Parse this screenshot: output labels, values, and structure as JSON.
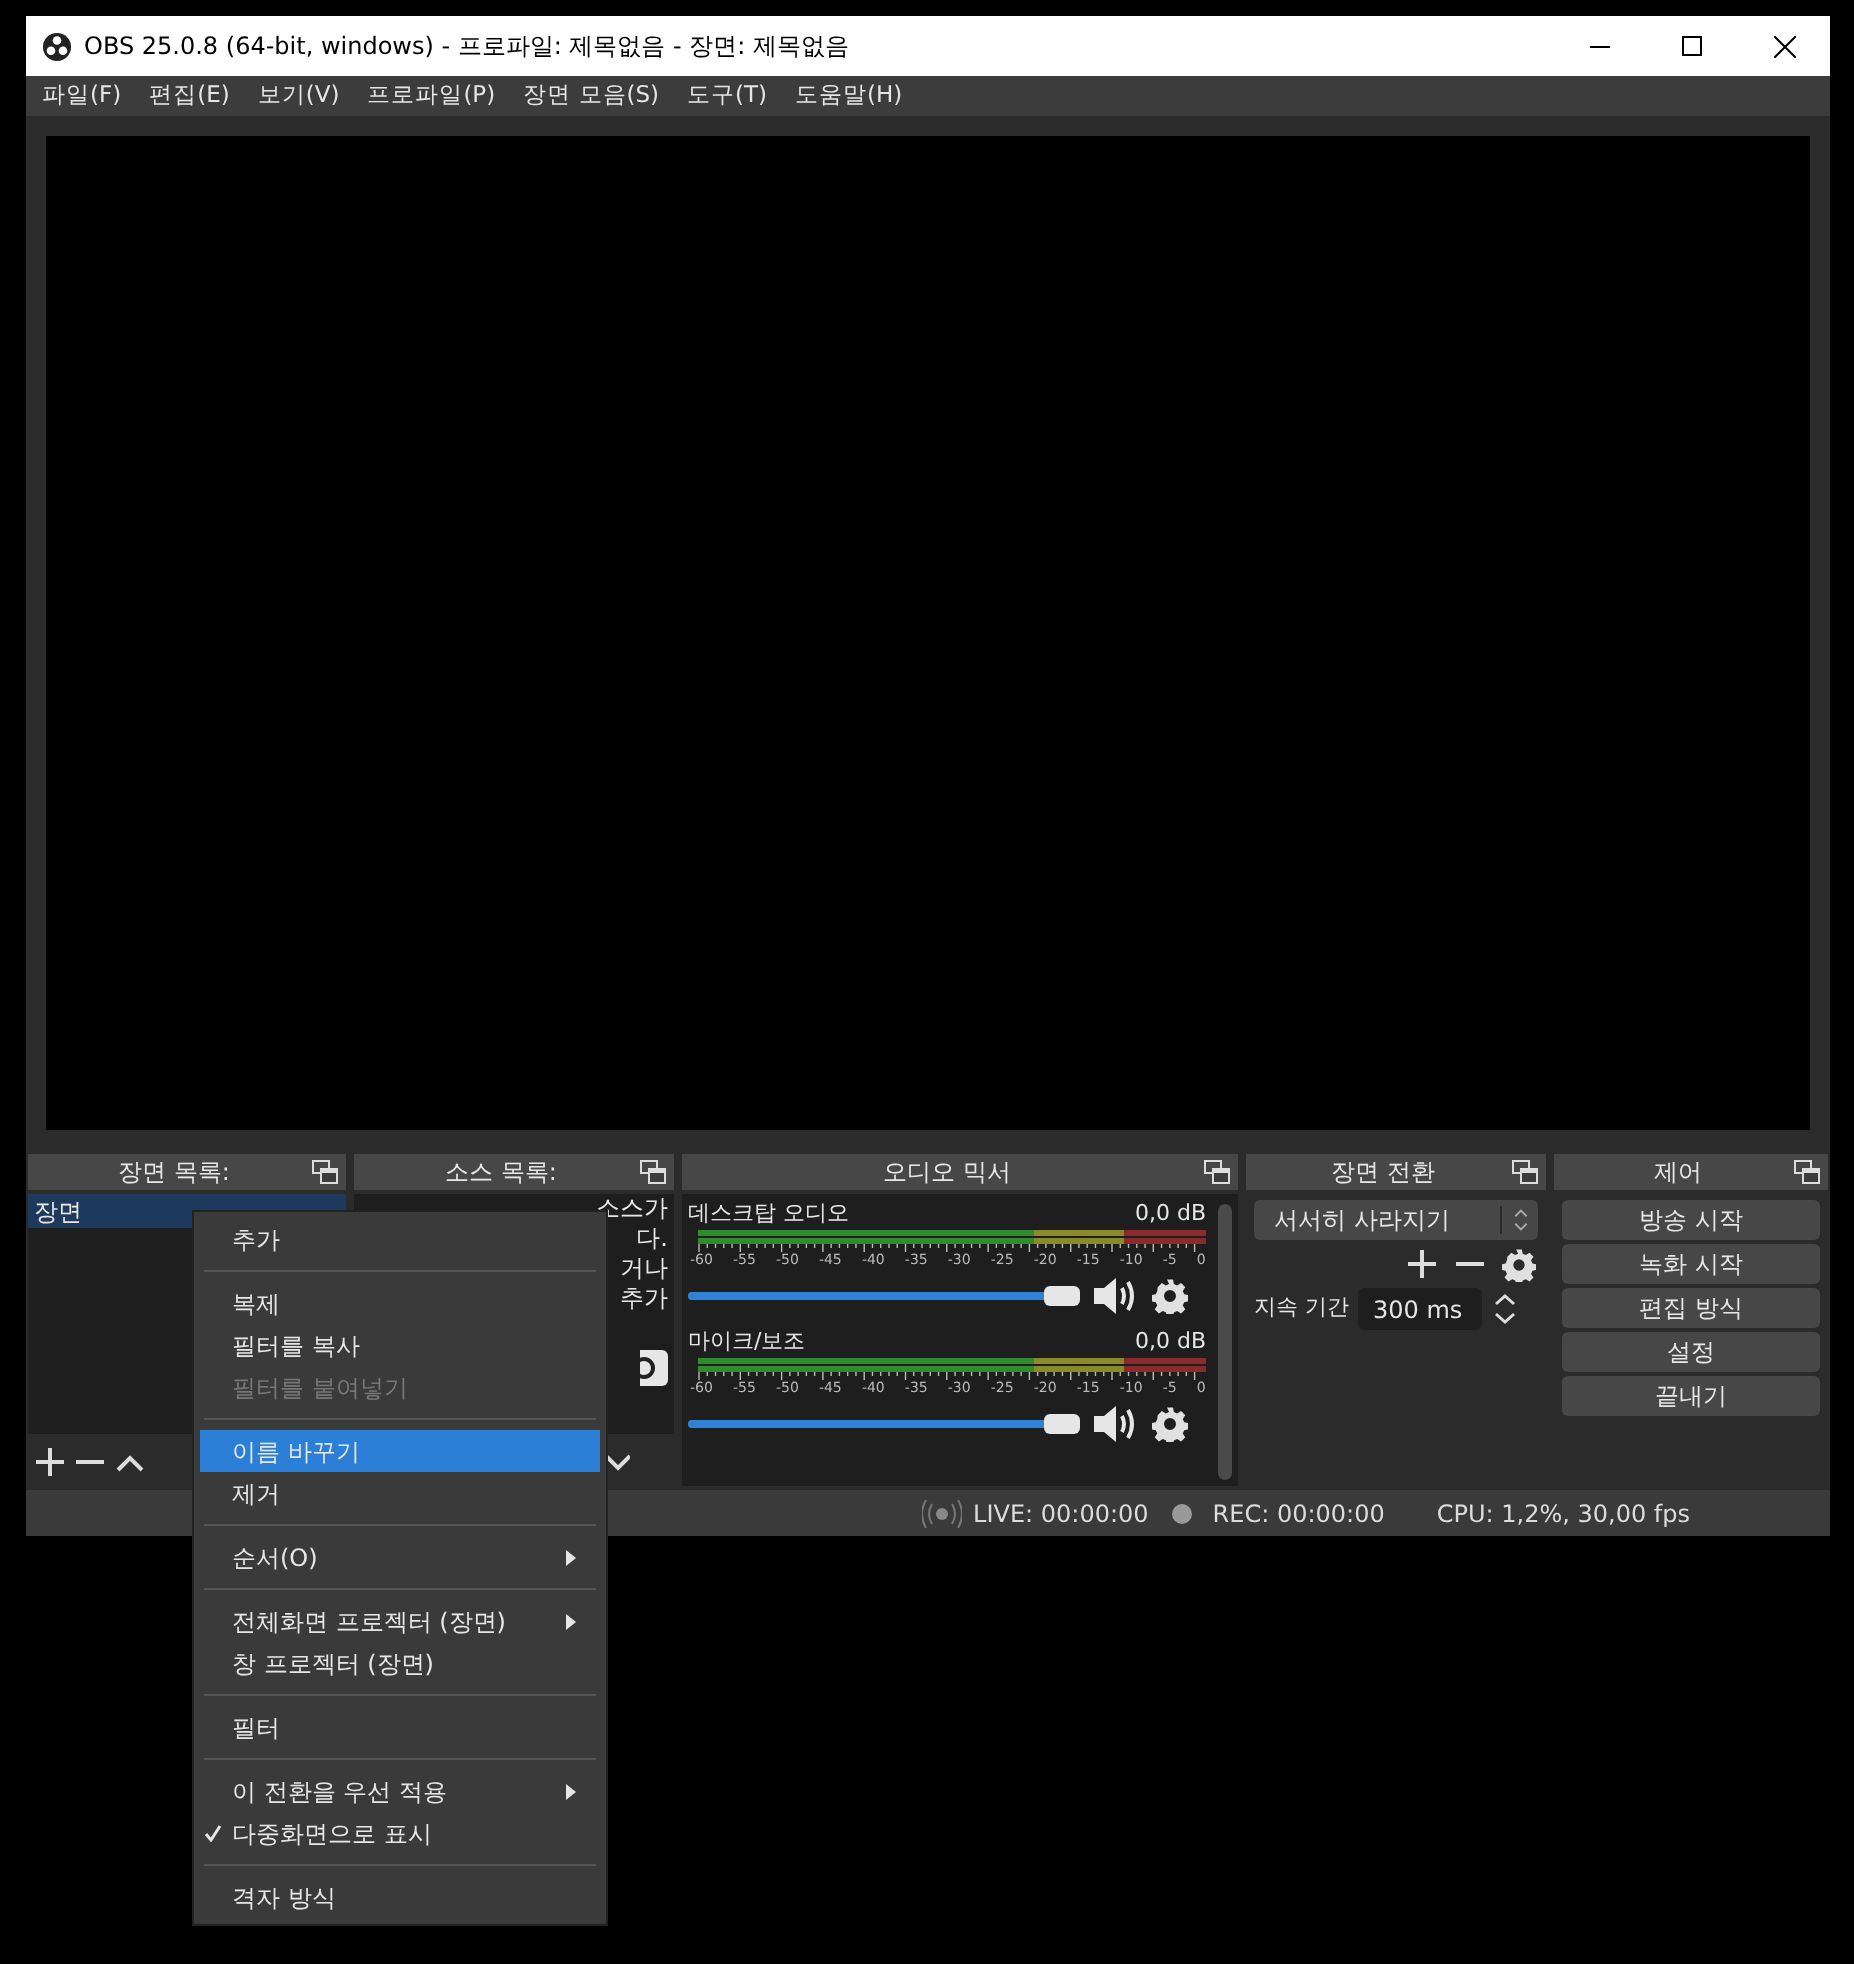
{
  "window": {
    "title": "OBS 25.0.8 (64-bit, windows) - 프로파일: 제목없음 - 장면: 제목없음"
  },
  "menubar": [
    "파일(F)",
    "편집(E)",
    "보기(V)",
    "프로파일(P)",
    "장면 모음(S)",
    "도구(T)",
    "도움말(H)"
  ],
  "scenes": {
    "title": "장면 목록:",
    "items": [
      {
        "label": "장면",
        "selected": true
      }
    ]
  },
  "sources": {
    "title": "소스 목록:",
    "text_lines": [
      "소스가",
      "다.",
      "거나",
      "추가"
    ]
  },
  "mixer": {
    "title": "오디오 믹서",
    "channels": [
      {
        "name": "데스크탑 오디오",
        "reading": "0,0 dB",
        "level": 1,
        "scale": [
          "-60",
          "-55",
          "-50",
          "-45",
          "-40",
          "-35",
          "-30",
          "-25",
          "-20",
          "-15",
          "-10",
          "-5",
          "0"
        ]
      },
      {
        "name": "마이크/보조",
        "reading": "0,0 dB",
        "level": 1,
        "scale": [
          "-60",
          "-55",
          "-50",
          "-45",
          "-40",
          "-35",
          "-30",
          "-25",
          "-20",
          "-15",
          "-10",
          "-5",
          "0"
        ]
      }
    ]
  },
  "transitions": {
    "title": "장면 전환",
    "selected": "서서히 사라지기",
    "duration_label": "지속 기간",
    "duration_value": "300 ms"
  },
  "controls": {
    "title": "제어",
    "buttons": [
      "방송 시작",
      "녹화 시작",
      "편집 방식",
      "설정",
      "끝내기"
    ]
  },
  "status_bar": {
    "live": "LIVE: 00:00:00",
    "rec": "REC: 00:00:00",
    "cpu": "CPU: 1,2%, 30,00 fps"
  },
  "context_menu": [
    {
      "kind": "item",
      "label": "추가",
      "disabled": false,
      "selected": false,
      "checked": false,
      "submenu": false
    },
    {
      "kind": "separator"
    },
    {
      "kind": "item",
      "label": "복제",
      "disabled": false,
      "selected": false,
      "checked": false,
      "submenu": false
    },
    {
      "kind": "item",
      "label": "필터를 복사",
      "disabled": false,
      "selected": false,
      "checked": false,
      "submenu": false
    },
    {
      "kind": "item",
      "label": "필터를 붙여넣기",
      "disabled": true,
      "selected": false,
      "checked": false,
      "submenu": false
    },
    {
      "kind": "separator"
    },
    {
      "kind": "item",
      "label": "이름 바꾸기",
      "disabled": false,
      "selected": true,
      "checked": false,
      "submenu": false
    },
    {
      "kind": "item",
      "label": "제거",
      "disabled": false,
      "selected": false,
      "checked": false,
      "submenu": false
    },
    {
      "kind": "separator"
    },
    {
      "kind": "item",
      "label": "순서(O)",
      "disabled": false,
      "selected": false,
      "checked": false,
      "submenu": true
    },
    {
      "kind": "separator"
    },
    {
      "kind": "item",
      "label": "전체화면 프로젝터 (장면)",
      "disabled": false,
      "selected": false,
      "checked": false,
      "submenu": true
    },
    {
      "kind": "item",
      "label": "창 프로젝터 (장면)",
      "disabled": false,
      "selected": false,
      "checked": false,
      "submenu": false
    },
    {
      "kind": "separator"
    },
    {
      "kind": "item",
      "label": "필터",
      "disabled": false,
      "selected": false,
      "checked": false,
      "submenu": false
    },
    {
      "kind": "separator"
    },
    {
      "kind": "item",
      "label": "이 전환을 우선 적용",
      "disabled": false,
      "selected": false,
      "checked": false,
      "submenu": true
    },
    {
      "kind": "item",
      "label": "다중화면으로 표시",
      "disabled": false,
      "selected": false,
      "checked": true,
      "submenu": false
    },
    {
      "kind": "separator"
    },
    {
      "kind": "item",
      "label": "격자 방식",
      "disabled": false,
      "selected": false,
      "checked": false,
      "submenu": false
    }
  ]
}
